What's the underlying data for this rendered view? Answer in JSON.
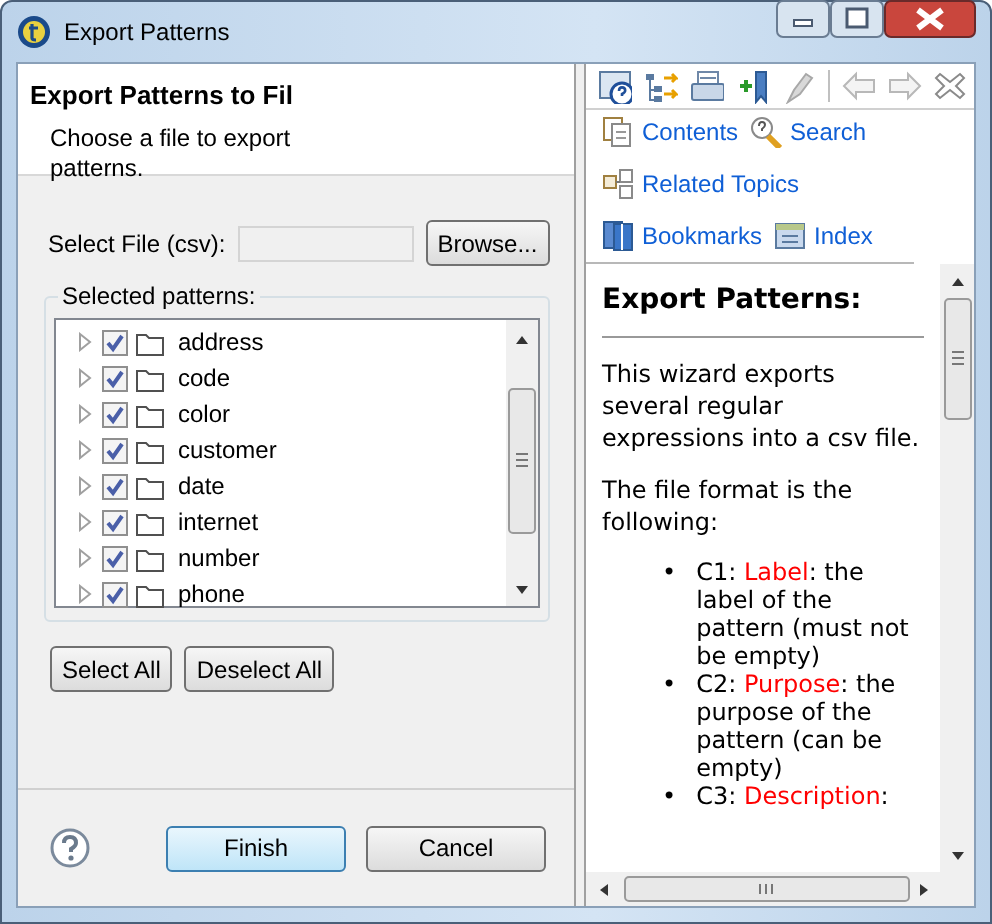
{
  "window": {
    "title": "Export Patterns"
  },
  "wizard": {
    "heading": "Export Patterns to Fil",
    "description": "Choose a file to export patterns.",
    "file_label": "Select File (csv):",
    "browse": "Browse...",
    "group_label": "Selected patterns:",
    "patterns": [
      {
        "name": "address",
        "checked": true,
        "expanded": false
      },
      {
        "name": "code",
        "checked": true,
        "expanded": false
      },
      {
        "name": "color",
        "checked": true,
        "expanded": false
      },
      {
        "name": "customer",
        "checked": true,
        "expanded": false
      },
      {
        "name": "date",
        "checked": true,
        "expanded": false
      },
      {
        "name": "internet",
        "checked": true,
        "expanded": false
      },
      {
        "name": "number",
        "checked": true,
        "expanded": false
      },
      {
        "name": "phone",
        "checked": true,
        "expanded": false
      }
    ],
    "select_all": "Select All",
    "deselect_all": "Deselect All",
    "finish": "Finish",
    "cancel": "Cancel"
  },
  "help": {
    "links": [
      {
        "label": "Contents",
        "kind": "contents"
      },
      {
        "label": "Search",
        "kind": "search"
      },
      {
        "label": "Related Topics",
        "kind": "related"
      },
      {
        "label": "Bookmarks",
        "kind": "bookmarks"
      },
      {
        "label": "Index",
        "kind": "index"
      }
    ],
    "title": "Export Patterns:",
    "paragraphs": [
      "This wizard exports several regular expressions into a csv file.",
      "The file format is the following:"
    ],
    "items": [
      {
        "marker": "•",
        "prefix": "C1: ",
        "term": "Label",
        "rest": ": the label of the pattern (must not be empty)"
      },
      {
        "marker": "•",
        "prefix": "C2: ",
        "term": "Purpose",
        "rest": ": the purpose of the pattern (can be empty)"
      },
      {
        "marker": "•",
        "prefix": "C3: ",
        "term": "Description",
        "rest": ":"
      }
    ]
  }
}
